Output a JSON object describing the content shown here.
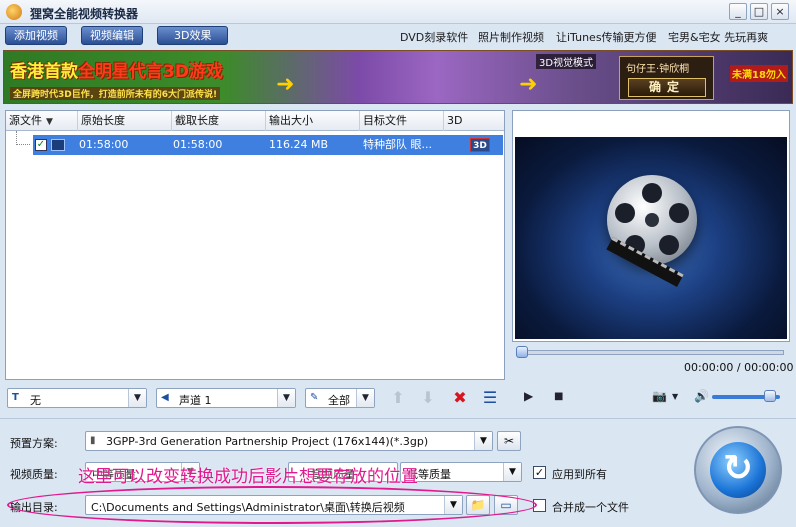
{
  "window": {
    "title": "狸窝全能视频转换器",
    "min": "_",
    "max": "□",
    "close": "×"
  },
  "toolbar": {
    "add_video": "添加视频",
    "edit_video": "视频编辑",
    "effect_3d": "3D效果",
    "links": [
      "DVD刻录软件",
      "照片制作视频",
      "让iTunes传输更方便",
      "宅男&宅女 先玩再爽"
    ]
  },
  "banner": {
    "headline_pre": "香港首款",
    "headline_hl": "全明星代言3D游戏",
    "subline": "全屏跨时代3D巨作，打造前所未有的6大门派传说!",
    "mode_label": "3D视觉模式",
    "game_name": "句仔王·钟欣桐",
    "confirm": "确定",
    "ribbon": "未满18勿入"
  },
  "table": {
    "columns": [
      "源文件",
      "原始长度",
      "截取长度",
      "输出大小",
      "目标文件",
      "3D"
    ],
    "rows": [
      {
        "original_length": "01:58:00",
        "cut_length": "01:58:00",
        "output_size": "116.24 MB",
        "target": "特种部队 眼...",
        "badge": "3D"
      }
    ]
  },
  "preview": {
    "time": "00:00:00 / 00:00:00"
  },
  "dropdowns": {
    "subtitle": "无",
    "audio": "声道 1",
    "range": "全部"
  },
  "settings": {
    "preset_label": "预置方案:",
    "preset_value": "3GPP-3rd Generation Partnership Project (176x144)(*.3gp)",
    "quality_label": "视频质量:",
    "quality_options": [
      "中等质量",
      "音频质量",
      "低等质量"
    ],
    "apply_all": "应用到所有",
    "output_label": "输出目录:",
    "output_path": "C:\\Documents and Settings\\Administrator\\桌面\\转换后视频",
    "merge": "合并成一个文件",
    "annotation": "这里可以改变转换成功后影片想要存放的位置"
  },
  "colors": {
    "accent": "#3f7fe0",
    "annotation": "#e01a8e"
  }
}
